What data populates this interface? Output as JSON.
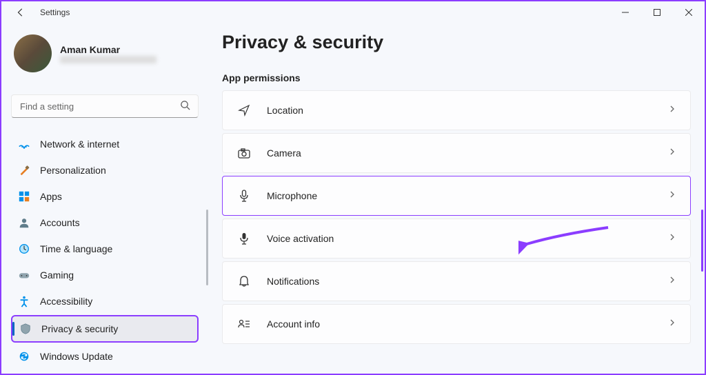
{
  "window": {
    "title": "Settings"
  },
  "user": {
    "name": "Aman Kumar",
    "email_masked": "hidden"
  },
  "search": {
    "placeholder": "Find a setting"
  },
  "sidebar": {
    "items": [
      {
        "icon": "wifi",
        "label": "Network & internet"
      },
      {
        "icon": "brush",
        "label": "Personalization"
      },
      {
        "icon": "apps",
        "label": "Apps"
      },
      {
        "icon": "person",
        "label": "Accounts"
      },
      {
        "icon": "clock-globe",
        "label": "Time & language"
      },
      {
        "icon": "gamepad",
        "label": "Gaming"
      },
      {
        "icon": "accessibility",
        "label": "Accessibility"
      },
      {
        "icon": "shield",
        "label": "Privacy & security"
      },
      {
        "icon": "sync",
        "label": "Windows Update"
      }
    ],
    "selected_index": 7
  },
  "page": {
    "title": "Privacy & security",
    "section": "App permissions",
    "permissions": [
      {
        "icon": "location",
        "label": "Location"
      },
      {
        "icon": "camera",
        "label": "Camera"
      },
      {
        "icon": "microphone",
        "label": "Microphone"
      },
      {
        "icon": "voice",
        "label": "Voice activation"
      },
      {
        "icon": "bell",
        "label": "Notifications"
      },
      {
        "icon": "account-info",
        "label": "Account info"
      }
    ],
    "highlighted_index": 2
  },
  "colors": {
    "accent": "#0067c0",
    "annotation": "#8b3dff"
  }
}
